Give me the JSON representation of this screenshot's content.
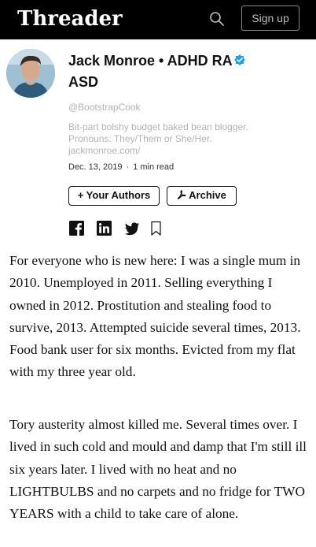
{
  "header": {
    "logo": "Threader",
    "search_icon": "search-icon",
    "signup_label": "Sign up"
  },
  "author": {
    "name": "Jack Monroe • ADHD RA ASD",
    "handle": "@BootstrapCook",
    "bio": "Bit-part bolshy budget baked bean blogger. Pronouns: They/Them or She/Her. jackmonroe.com/",
    "date": "Dec. 13, 2019",
    "read_time": "1 min read",
    "verified_color": "#1da1f2"
  },
  "actions": {
    "your_authors_label": "+ Your Authors",
    "archive_label": "Archive",
    "archive_icon": "pdf-icon"
  },
  "share": [
    "facebook-icon",
    "linkedin-icon",
    "twitter-icon",
    "bookmark-icon"
  ],
  "thread": {
    "paragraphs": [
      "For everyone who is new here: I was a single mum in 2010. Unemployed in 2011. Selling everything I owned in 2012. Prostitution and stealing food to survive, 2013. Attempted suicide several times, 2013. Food bank user for six months. Evicted from my flat with my three year old.",
      "Tory austerity almost killed me. Several times over. I lived in such cold and mould and damp that I'm still ill six years later. I lived with no heat and no LIGHTBULBS and no carpets and no fridge for TWO YEARS with a child to take care of alone."
    ]
  }
}
